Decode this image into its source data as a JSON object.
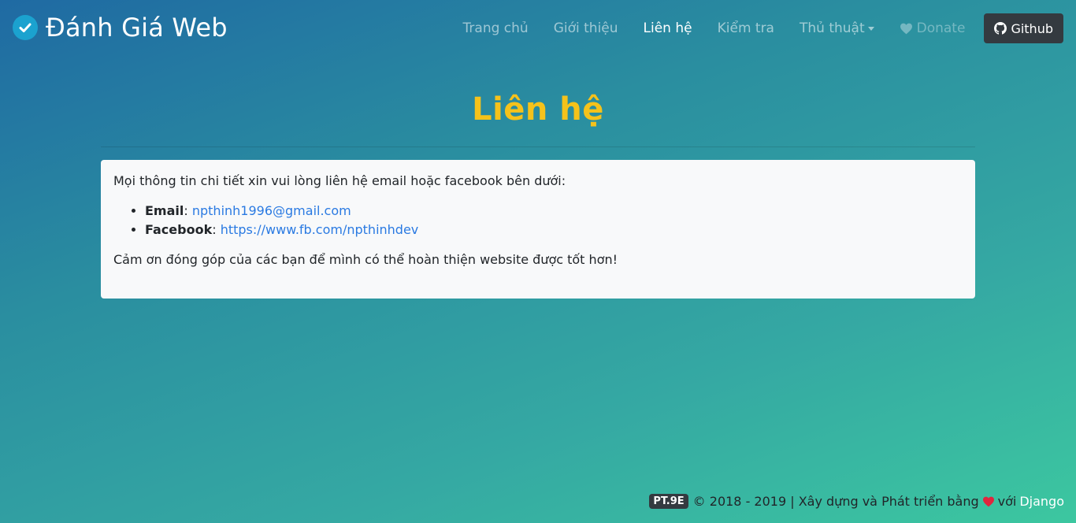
{
  "brand": {
    "title": "Đánh Giá Web",
    "icon": "check-circle-icon"
  },
  "nav": {
    "items": [
      {
        "label": "Trang chủ"
      },
      {
        "label": "Giới thiệu"
      },
      {
        "label": "Liên hệ",
        "active": true
      },
      {
        "label": "Kiểm tra"
      },
      {
        "label": "Thủ thuật"
      },
      {
        "label": "Donate",
        "icon": "heart-icon"
      }
    ],
    "github_label": "Github"
  },
  "page": {
    "title": "Liên hệ",
    "intro": "Mọi thông tin chi tiết xin vui lòng liên hệ email hoặc facebook bên dưới:",
    "email_label": "Email",
    "email_value": "npthinh1996@gmail.com",
    "facebook_label": "Facebook",
    "facebook_value": "https://www.fb.com/npthinhdev",
    "thanks": "Cảm ơn đóng góp của các bạn để mình có thể hoàn thiện website được tốt hơn!"
  },
  "footer": {
    "badge": "PT.9E",
    "text": "© 2018 - 2019 | Xây dựng và Phát triển bằng",
    "with": "với",
    "django": "Django"
  },
  "colors": {
    "title": "#f5c21b",
    "link": "#2a7ae2",
    "heart": "#e0263e",
    "dark": "#343a40"
  }
}
